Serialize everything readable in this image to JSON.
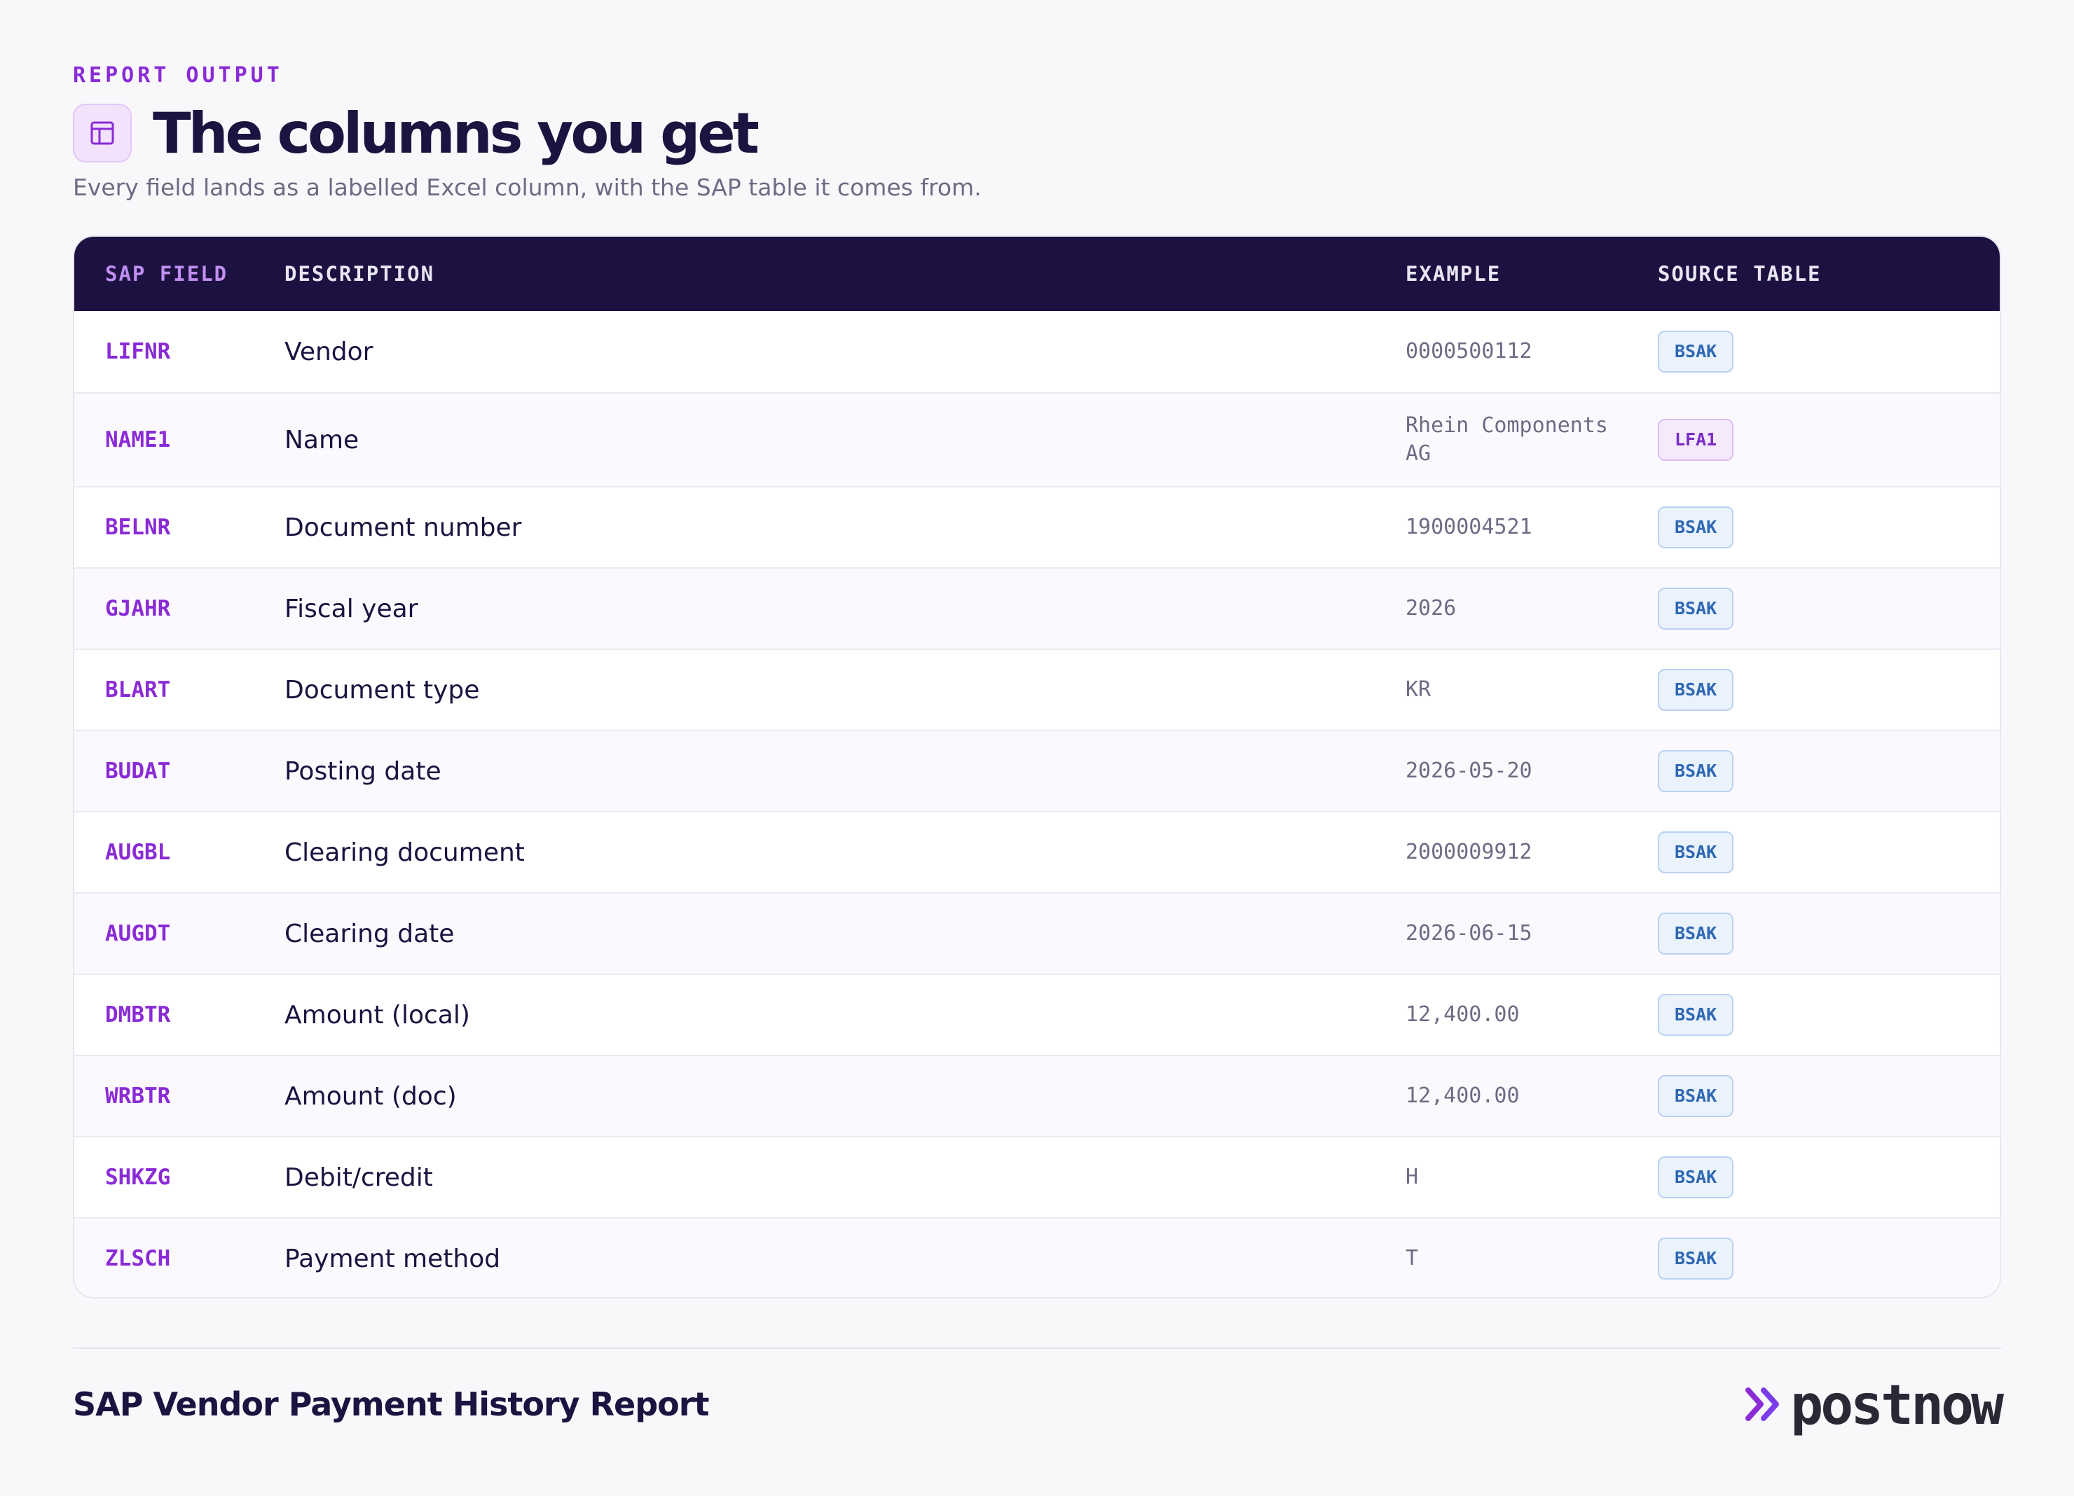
{
  "header": {
    "eyebrow": "REPORT OUTPUT",
    "title": "The columns you get",
    "subtitle": "Every field lands as a labelled Excel column, with the SAP table it comes from.",
    "icon": "table-layout-icon"
  },
  "table": {
    "columns": {
      "field": "SAP FIELD",
      "description": "DESCRIPTION",
      "example": "EXAMPLE",
      "source": "SOURCE TABLE"
    },
    "rows": [
      {
        "field": "LIFNR",
        "description": "Vendor",
        "example": "0000500112",
        "source": "BSAK"
      },
      {
        "field": "NAME1",
        "description": "Name",
        "example": "Rhein Components AG",
        "source": "LFA1"
      },
      {
        "field": "BELNR",
        "description": "Document number",
        "example": "1900004521",
        "source": "BSAK"
      },
      {
        "field": "GJAHR",
        "description": "Fiscal year",
        "example": "2026",
        "source": "BSAK"
      },
      {
        "field": "BLART",
        "description": "Document type",
        "example": "KR",
        "source": "BSAK"
      },
      {
        "field": "BUDAT",
        "description": "Posting date",
        "example": "2026-05-20",
        "source": "BSAK"
      },
      {
        "field": "AUGBL",
        "description": "Clearing document",
        "example": "2000009912",
        "source": "BSAK"
      },
      {
        "field": "AUGDT",
        "description": "Clearing date",
        "example": "2026-06-15",
        "source": "BSAK"
      },
      {
        "field": "DMBTR",
        "description": "Amount (local)",
        "example": "12,400.00",
        "source": "BSAK"
      },
      {
        "field": "WRBTR",
        "description": "Amount (doc)",
        "example": "12,400.00",
        "source": "BSAK"
      },
      {
        "field": "SHKZG",
        "description": "Debit/credit",
        "example": "H",
        "source": "BSAK"
      },
      {
        "field": "ZLSCH",
        "description": "Payment method",
        "example": "T",
        "source": "BSAK"
      }
    ]
  },
  "footer": {
    "title": "SAP Vendor Payment History Report",
    "brand": "postnow",
    "brand_icon": "double-chevron-right-icon"
  },
  "colors": {
    "accent": "#8a2bd6",
    "header_bg": "#1c1140",
    "text_dark": "#1c1340",
    "text_muted": "#6f6b84",
    "badge_bsak": "#2e67b3",
    "badge_lfa1": "#7a2cc4"
  }
}
